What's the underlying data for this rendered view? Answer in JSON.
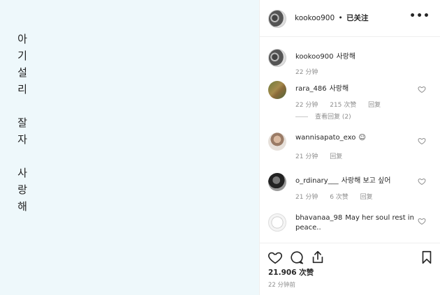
{
  "post": {
    "text_lines": [
      "아",
      "기",
      "설",
      "리",
      "",
      "잘",
      "자",
      "",
      "사",
      "랑",
      "해"
    ]
  },
  "header": {
    "username": "kookoo900",
    "separator": "•",
    "follow_label": "已关注",
    "more_icon": "more-icon"
  },
  "comments": [
    {
      "username": "kookoo900",
      "text": "사랑해",
      "time": "22 分钟",
      "likes": "",
      "reply": ""
    },
    {
      "username": "rara_486",
      "text": "사랑해",
      "time": "22 分钟",
      "likes": "215 次赞",
      "reply": "回复",
      "view_replies": "查看回复 (2)"
    },
    {
      "username": "wannisapato_exo",
      "text": "☺",
      "time": "21 分钟",
      "likes": "",
      "reply": "回复"
    },
    {
      "username": "o_rdinary___",
      "text": "사랑해 보고 싶어",
      "time": "21 分钟",
      "likes": "6 次赞",
      "reply": "回复"
    },
    {
      "username": "bhavanaa_98",
      "text": "May her soul rest in",
      "text2": "peace..",
      "time": "",
      "likes": "",
      "reply": ""
    }
  ],
  "footer": {
    "likes": "21.906 次赞",
    "time": "22 分钟前"
  }
}
